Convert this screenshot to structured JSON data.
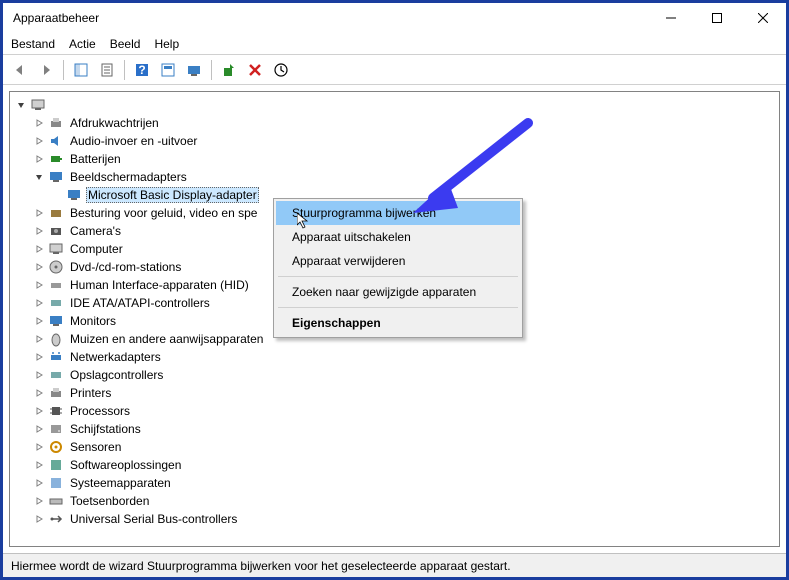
{
  "window": {
    "title": "Apparaatbeheer"
  },
  "menu": {
    "file": "Bestand",
    "action": "Actie",
    "view": "Beeld",
    "help": "Help"
  },
  "tree": {
    "root": "",
    "items": [
      {
        "label": "Afdrukwachtrijen"
      },
      {
        "label": "Audio-invoer en -uitvoer"
      },
      {
        "label": "Batterijen"
      },
      {
        "label": "Beeldschermadapters",
        "expanded": true,
        "child": "Microsoft Basic Display-adapter"
      },
      {
        "label": "Besturing voor geluid, video en spe"
      },
      {
        "label": "Camera's"
      },
      {
        "label": "Computer"
      },
      {
        "label": "Dvd-/cd-rom-stations"
      },
      {
        "label": "Human Interface-apparaten (HID)"
      },
      {
        "label": "IDE ATA/ATAPI-controllers"
      },
      {
        "label": "Monitors"
      },
      {
        "label": "Muizen en andere aanwijsapparaten"
      },
      {
        "label": "Netwerkadapters"
      },
      {
        "label": "Opslagcontrollers"
      },
      {
        "label": "Printers"
      },
      {
        "label": "Processors"
      },
      {
        "label": "Schijfstations"
      },
      {
        "label": "Sensoren"
      },
      {
        "label": "Softwareoplossingen"
      },
      {
        "label": "Systeemapparaten"
      },
      {
        "label": "Toetsenborden"
      },
      {
        "label": "Universal Serial Bus-controllers"
      }
    ]
  },
  "context_menu": {
    "update_driver": "Stuurprogramma bijwerken",
    "disable": "Apparaat uitschakelen",
    "uninstall": "Apparaat verwijderen",
    "scan": "Zoeken naar gewijzigde apparaten",
    "properties": "Eigenschappen"
  },
  "status": "Hiermee wordt de wizard Stuurprogramma bijwerken voor het geselecteerde apparaat gestart."
}
